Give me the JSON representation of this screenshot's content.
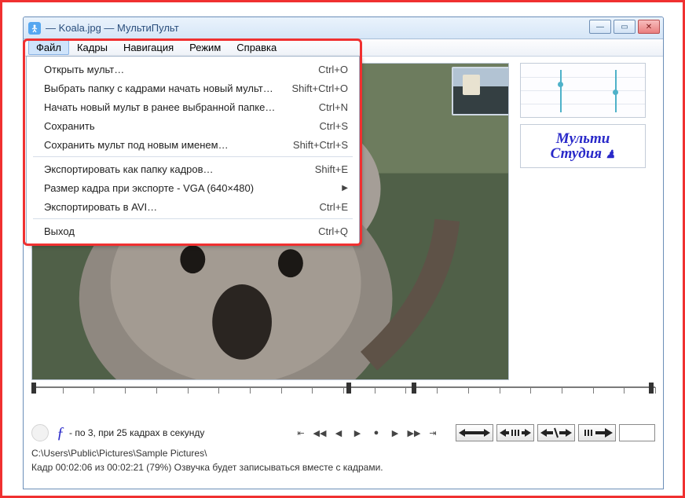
{
  "title": " — Koala.jpg — МультиПульт",
  "menus": {
    "file": "Файл",
    "frames": "Кадры",
    "nav": "Навигация",
    "mode": "Режим",
    "help": "Справка"
  },
  "file_menu": [
    {
      "label": "Открыть мульт…",
      "shortcut": "Ctrl+O",
      "type": "item"
    },
    {
      "label": "Выбрать папку с кадрами начать новый мульт…",
      "shortcut": "Shift+Ctrl+O",
      "type": "item"
    },
    {
      "label": "Начать новый мульт в ранее выбранной папке…",
      "shortcut": "Ctrl+N",
      "type": "item"
    },
    {
      "label": "Сохранить",
      "shortcut": "Ctrl+S",
      "type": "item"
    },
    {
      "label": "Сохранить мульт под новым именем…",
      "shortcut": "Shift+Ctrl+S",
      "type": "item"
    },
    {
      "type": "sep"
    },
    {
      "label": "Экспортировать как папку кадров…",
      "shortcut": "Shift+E",
      "type": "item"
    },
    {
      "label": "Размер кадра при экспорте - VGA (640×480)",
      "shortcut": "",
      "type": "submenu"
    },
    {
      "label": "Экспортировать в AVI…",
      "shortcut": "Ctrl+E",
      "type": "item"
    },
    {
      "type": "sep"
    },
    {
      "label": "Выход",
      "shortcut": "Ctrl+Q",
      "type": "item"
    }
  ],
  "logo_line1": "Мульти",
  "logo_line2": "Студия",
  "playback_info": " - по 3, при 25 кадрах в секунду",
  "path": "C:\\Users\\Public\\Pictures\\Sample Pictures\\",
  "status": "Кадр 00:02:06 из 00:02:21 (79%) Озвучка будет записываться вместе с кадрами."
}
